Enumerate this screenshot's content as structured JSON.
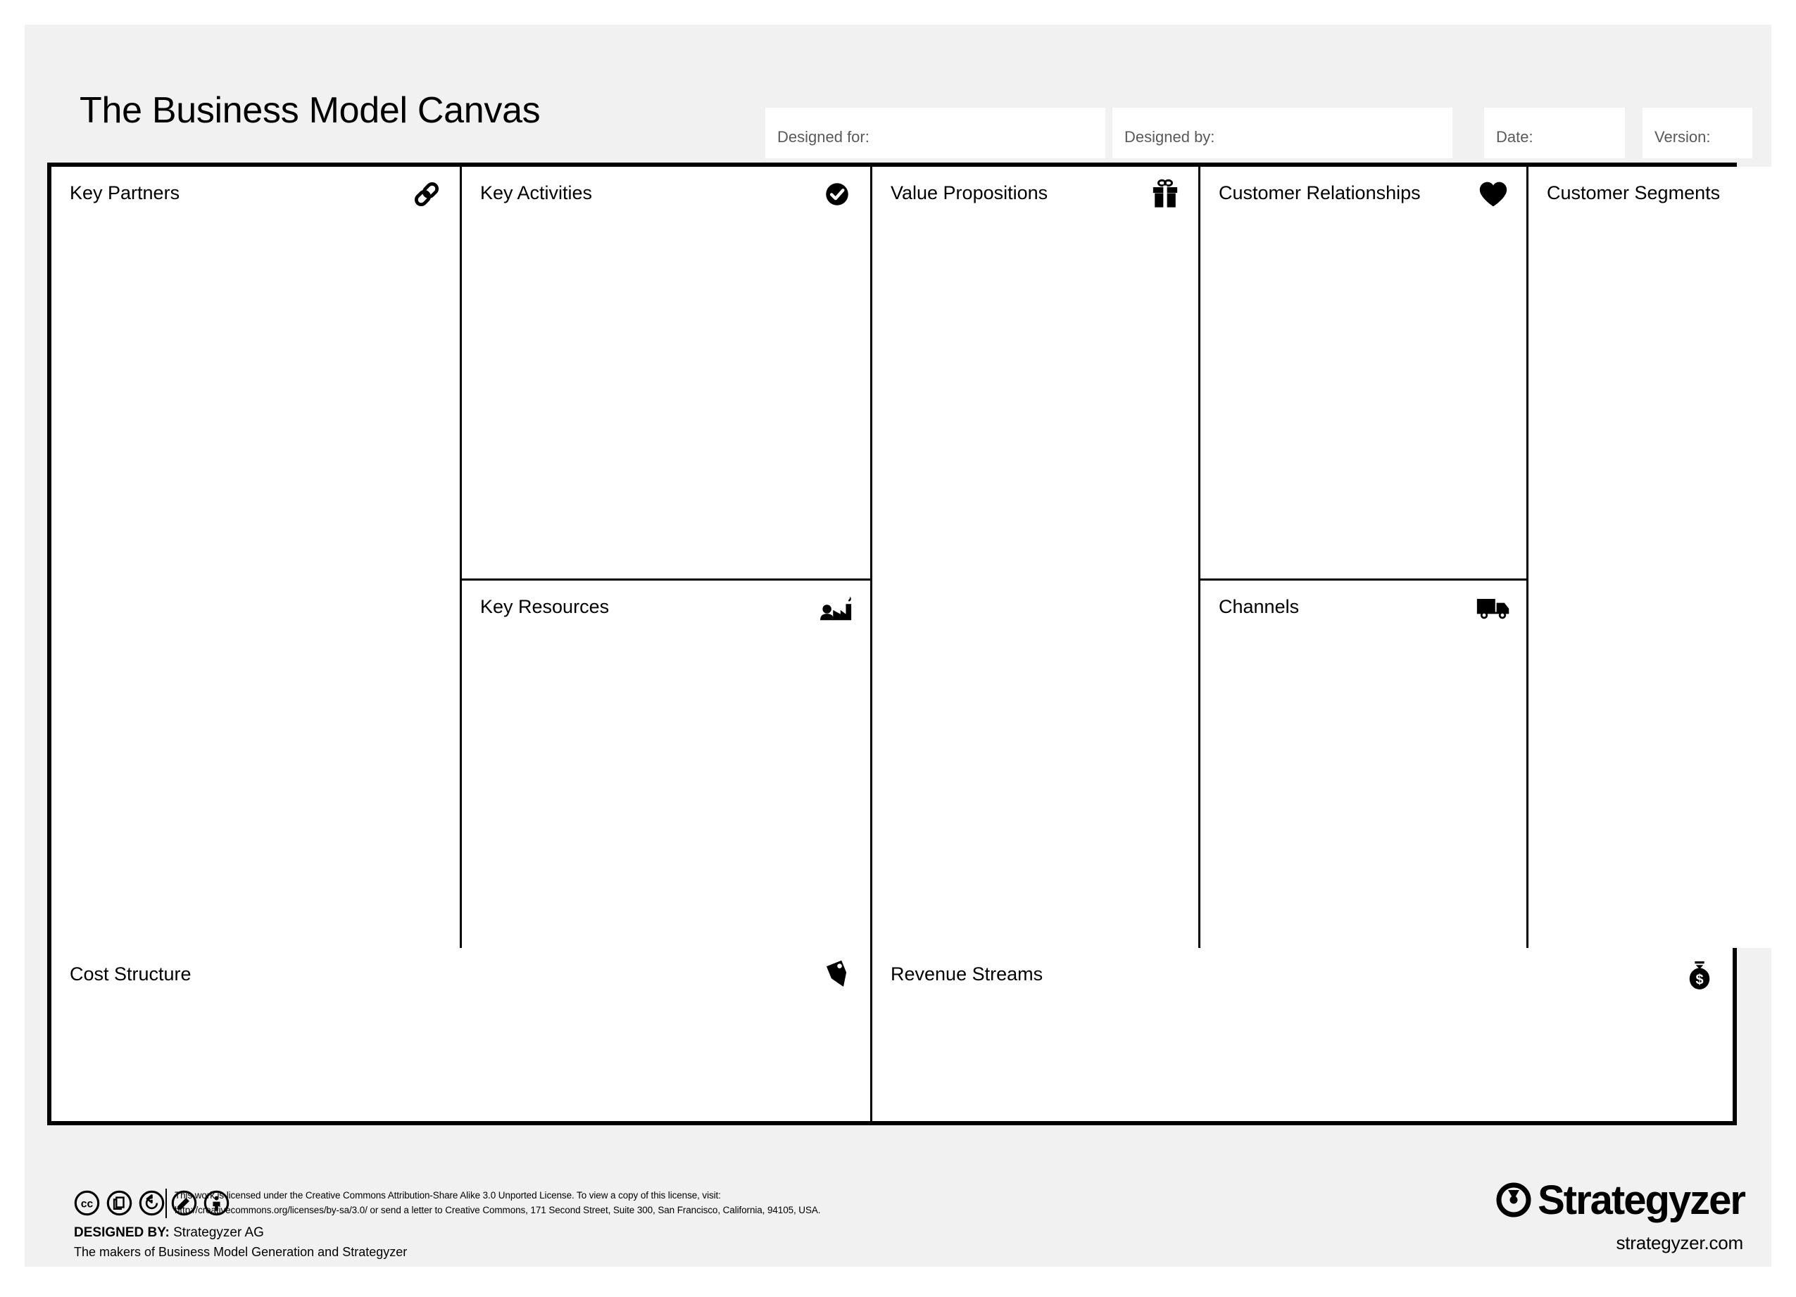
{
  "page": {
    "title": "The Business Model Canvas",
    "background_color": "#f1f1f1",
    "canvas_background": "#ffffff",
    "line_color": "#000000"
  },
  "header": {
    "title": "The Business Model Canvas",
    "meta_fields": [
      {
        "label": "Designed for:",
        "value": "",
        "name": "designed-for"
      },
      {
        "label": "Designed by:",
        "value": "",
        "name": "designed-by"
      },
      {
        "label": "Date:",
        "value": "",
        "name": "date"
      },
      {
        "label": "Version:",
        "value": "",
        "name": "version"
      }
    ]
  },
  "canvas": {
    "blocks": {
      "key_partners": {
        "title": "Key Partners",
        "icon": "chain-link-icon",
        "content": ""
      },
      "key_activities": {
        "title": "Key Activities",
        "icon": "check-circle-icon",
        "content": ""
      },
      "key_resources": {
        "title": "Key Resources",
        "icon": "factory-worker-icon",
        "content": ""
      },
      "value_propositions": {
        "title": "Value Propositions",
        "icon": "gift-icon",
        "content": ""
      },
      "customer_relationships": {
        "title": "Customer Relationships",
        "icon": "heart-icon",
        "content": ""
      },
      "channels": {
        "title": "Channels",
        "icon": "delivery-truck-icon",
        "content": ""
      },
      "customer_segments": {
        "title": "Customer Segments",
        "icon": "head-profile-icon",
        "content": ""
      },
      "cost_structure": {
        "title": "Cost Structure",
        "icon": "price-tag-icon",
        "content": ""
      },
      "revenue_streams": {
        "title": "Revenue Streams",
        "icon": "money-bag-icon",
        "content": ""
      }
    }
  },
  "footer": {
    "cc_badges": [
      "cc-logo-icon",
      "cc-share-icon",
      "cc-share-alike-icon",
      "cc-remix-icon",
      "cc-attribution-icon"
    ],
    "license_line_1": "This work is licensed under the Creative Commons Attribution-Share Alike 3.0 Unported License. To view a copy of this license, visit:",
    "license_line_2": "http://creativecommons.org/licenses/by-sa/3.0/ or send a letter to Creative Commons, 171 Second Street, Suite 300, San Francisco, California, 94105, USA.",
    "designed_by_label": "DESIGNED BY:",
    "designed_by_value": "Strategyzer AG",
    "makers_line": "The makers of Business Model Generation and Strategyzer",
    "brand_name": "Strategyzer",
    "brand_url": "strategyzer.com"
  }
}
